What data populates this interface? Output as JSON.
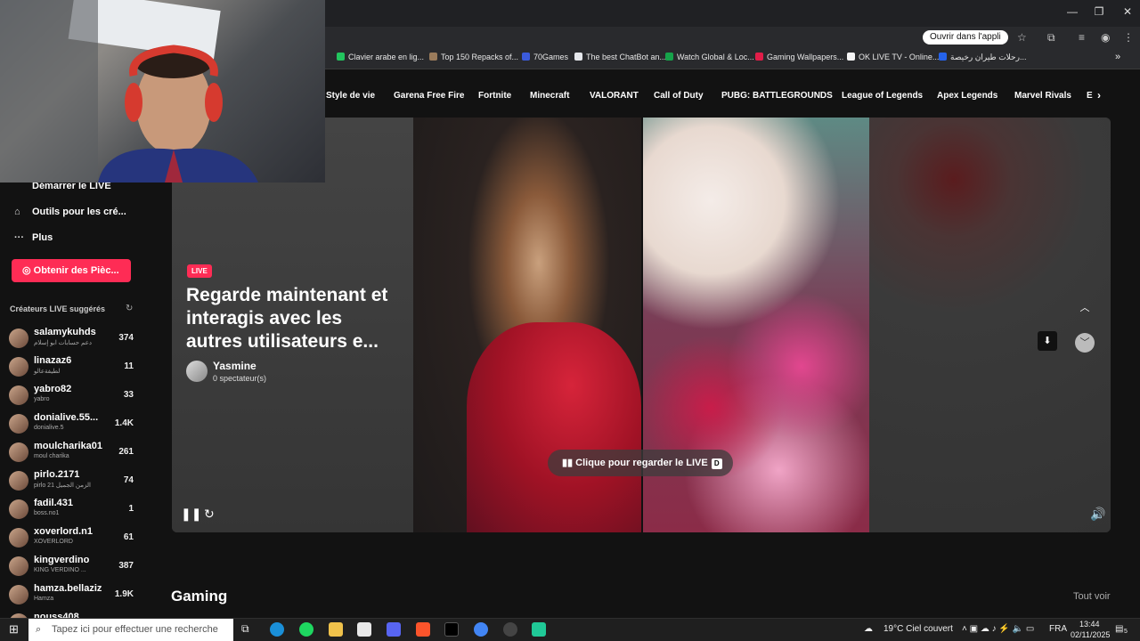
{
  "browser": {
    "open_app": "Ouvrir dans l'appli",
    "window_controls": {
      "minimize": "—",
      "maximize": "❐",
      "close": "✕"
    },
    "bookmarks": [
      {
        "label": "Clavier arabe en lig...",
        "color": "#22c55e"
      },
      {
        "label": "Top 150 Repacks of...",
        "color": "#9a7b5b"
      },
      {
        "label": "70Games",
        "color": "#3b5bdb"
      },
      {
        "label": "The best ChatBot an...",
        "color": "#e5e7eb"
      },
      {
        "label": "Watch Global & Loc...",
        "color": "#16a34a"
      },
      {
        "label": "Gaming Wallpapers...",
        "color": "#e11d48"
      },
      {
        "label": "OK LIVE TV - Online...",
        "color": "#f5f5f5"
      },
      {
        "label": "رحلات طيران رخيصة...",
        "color": "#2563eb"
      }
    ]
  },
  "categories": [
    "Style de vie",
    "Garena Free Fire",
    "Fortnite",
    "Minecraft",
    "VALORANT",
    "Call of Duty",
    "PUBG: BATTLEGROUNDS",
    "League of Legends",
    "Apex Legends",
    "Marvel Rivals",
    "E"
  ],
  "sidebar": {
    "items": [
      {
        "label": "Démarrer le LIVE",
        "icon": "live-icon"
      },
      {
        "label": "Outils pour les cré...",
        "icon": "tools-icon"
      },
      {
        "label": "Plus",
        "icon": "more-icon"
      }
    ],
    "coins_button": "Obtenir des Pièc...",
    "suggested_title": "Créateurs LIVE suggérés",
    "creators": [
      {
        "name": "salamykuhds",
        "sub": "دعم حسابات ابو إسلام",
        "count": "374"
      },
      {
        "name": "linazaz6",
        "sub": "لطيفةعالو",
        "count": "11"
      },
      {
        "name": "yabro82",
        "sub": "yabro",
        "count": "33"
      },
      {
        "name": "donialive.55...",
        "sub": "donialive.5",
        "count": "1.4K"
      },
      {
        "name": "moulcharika01",
        "sub": "moul charika",
        "count": "261"
      },
      {
        "name": "pirlo.2171",
        "sub": "pirlo 21 الزمن الجميل",
        "count": "74"
      },
      {
        "name": "fadil.431",
        "sub": "boss.no1",
        "count": "1"
      },
      {
        "name": "xoverlord.n1",
        "sub": "XOVERLORD",
        "count": "61"
      },
      {
        "name": "kingverdino",
        "sub": "KING VERDINO ...",
        "count": "387"
      },
      {
        "name": "hamza.bellaziz",
        "sub": "Hamza",
        "count": "1.9K"
      },
      {
        "name": "nouss408",
        "sub": "",
        "count": ""
      }
    ]
  },
  "player": {
    "live_badge": "LIVE",
    "headline": "Regarde maintenant et interagis avec les autres utilisateurs e...",
    "host_name": "Yasmine",
    "host_viewers": "0 spectateur(s)",
    "cta": "Clique pour regarder le LIVE",
    "cta_key": "D"
  },
  "section": {
    "title": "Gaming",
    "see_all": "Tout voir"
  },
  "taskbar": {
    "search_placeholder": "Tapez ici pour effectuer une recherche",
    "weather": "19°C  Ciel couvert",
    "lang": "FRA",
    "time": "13:44",
    "date": "02/11/2025",
    "notif_count": "5"
  }
}
